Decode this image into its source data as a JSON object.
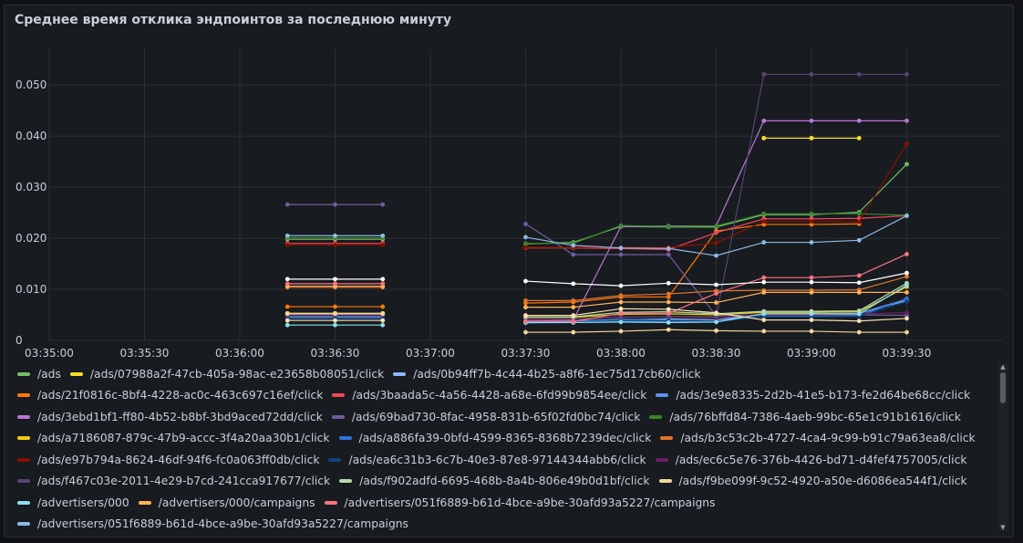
{
  "panel": {
    "title": "Среднее время отклика эндпоинтов за последнюю минуту"
  },
  "chart_data": {
    "type": "line",
    "title": "Среднее время отклика эндпоинтов за последнюю минуту",
    "x_ticks": [
      "03:35:00",
      "03:35:30",
      "03:36:00",
      "03:36:30",
      "03:37:00",
      "03:37:30",
      "03:38:00",
      "03:38:30",
      "03:39:00",
      "03:39:30"
    ],
    "y_ticks": [
      "0",
      "0.010",
      "0.020",
      "0.030",
      "0.040",
      "0.050"
    ],
    "xlim": [
      "03:35:00",
      "03:40:00"
    ],
    "ylim": [
      0,
      0.057
    ],
    "grid": true,
    "legend_position": "bottom",
    "x": [
      "03:36:15",
      "03:36:30",
      "03:36:45",
      "03:37:30",
      "03:37:45",
      "03:38:00",
      "03:38:15",
      "03:38:30",
      "03:38:45",
      "03:39:00",
      "03:39:15",
      "03:39:30"
    ],
    "series": [
      {
        "name": "/ads",
        "color": "#73bf69",
        "values": [
          0.0198,
          0.0198,
          0.0198,
          0.0189,
          0.0192,
          0.0223,
          0.0222,
          0.0222,
          0.0246,
          0.0246,
          0.0251,
          0.0345
        ]
      },
      {
        "name": "/ads/07988a2f-47cb-405a-98ac-e23658b08051/click",
        "color": "#fade2a",
        "values": [
          null,
          null,
          null,
          null,
          null,
          null,
          null,
          null,
          0.0396,
          0.0396,
          0.0396,
          null
        ]
      },
      {
        "name": "/ads/0b94ff7b-4c44-4b25-a8f6-1ec75d17cb60/click",
        "color": "#8ab8ff",
        "values": [
          0.0046,
          0.0046,
          0.0046,
          0.0036,
          0.0037,
          0.004,
          0.0042,
          0.004,
          0.0052,
          0.0052,
          0.0053,
          0.0078
        ]
      },
      {
        "name": "/ads/21f0816c-8bf4-4228-ac0c-463c697c16ef/click",
        "color": "#ff780a",
        "values": [
          0.0066,
          0.0066,
          0.0066,
          0.0073,
          0.0075,
          0.0085,
          0.0085,
          0.0214,
          0.0227,
          0.0227,
          0.0228,
          null
        ]
      },
      {
        "name": "/ads/3baada5c-4a56-4428-a68e-6fd99b9854ee/click",
        "color": "#f2495c",
        "values": [
          0.019,
          0.019,
          0.019,
          0.0181,
          0.0181,
          0.018,
          0.0178,
          0.0211,
          0.0238,
          0.0238,
          0.0239,
          0.0244
        ]
      },
      {
        "name": "/ads/3e9e8335-2d2b-41e5-b173-fe2d64be68cc/click",
        "color": "#5794f2",
        "values": [
          0.0052,
          0.0052,
          0.0052,
          0.0037,
          0.0038,
          0.0041,
          0.004,
          0.0037,
          0.0052,
          0.0052,
          0.0053,
          0.0081
        ]
      },
      {
        "name": "/ads/3ebd1bf1-ff80-4b52-b8bf-3bd9aced72dd/click",
        "color": "#b877d9",
        "values": [
          0.005,
          0.005,
          0.005,
          0.0039,
          0.004,
          0.0223,
          0.0224,
          0.0224,
          0.043,
          0.043,
          0.043,
          0.043
        ]
      },
      {
        "name": "/ads/69bad730-8fac-4958-831b-65f02fd0bc74/click",
        "color": "#705da0",
        "values": [
          0.0266,
          0.0266,
          0.0266,
          0.0228,
          0.0168,
          0.0168,
          0.0168,
          0.0048,
          0.005,
          0.005,
          0.005,
          0.0049
        ]
      },
      {
        "name": "/ads/76bffd84-7386-4aeb-99bc-65e1c91b1616/click",
        "color": "#37872d",
        "values": [
          0.0201,
          0.0201,
          0.0201,
          0.019,
          0.019,
          0.0225,
          0.0223,
          0.0224,
          0.0248,
          0.0248,
          0.0248,
          0.0245
        ]
      },
      {
        "name": "/ads/a7186087-879c-47b9-accc-3f4a20aa30b1/click",
        "color": "#f2cc0c",
        "values": [
          0.0053,
          0.0053,
          0.0053,
          0.0045,
          0.0045,
          0.0051,
          0.0052,
          0.005,
          0.0055,
          0.0055,
          0.0056,
          0.0105
        ]
      },
      {
        "name": "/ads/a886fa39-0bfd-4599-8365-8368b7239dec/click",
        "color": "#3274d9",
        "values": [
          0.0043,
          0.0043,
          0.0043,
          0.0034,
          0.0035,
          0.0037,
          0.0038,
          0.0037,
          0.0047,
          0.0047,
          0.0048,
          0.0082
        ]
      },
      {
        "name": "/ads/b3c53c2b-4727-4ca4-9c99-b91c79a63ea8/click",
        "color": "#e0752d",
        "values": [
          0.0104,
          0.0104,
          0.0104,
          0.0078,
          0.0078,
          0.0088,
          0.0091,
          0.0097,
          0.0098,
          0.0098,
          0.0099,
          0.0125
        ]
      },
      {
        "name": "/ads/e97b794a-8624-46df-94f6-fc0a063ff0db/click",
        "color": "#890f02",
        "values": [
          0.0187,
          0.0187,
          0.0187,
          0.0182,
          0.0182,
          0.0182,
          0.0182,
          0.0191,
          0.0233,
          0.0233,
          0.0232,
          0.0385
        ]
      },
      {
        "name": "/ads/ea6c31b3-6c7b-40e3-87e8-97144344abb6/click",
        "color": "#0a437c",
        "values": [
          0.0044,
          0.0044,
          0.0044,
          0.0036,
          0.0036,
          0.0039,
          0.0039,
          0.0038,
          0.0046,
          0.0046,
          0.0047,
          0.0076
        ]
      },
      {
        "name": "/ads/ec6c5e76-376b-4426-bd71-d4fef4757005/click",
        "color": "#6d1f62",
        "values": [
          0.0049,
          0.0049,
          0.0049,
          0.0042,
          0.0042,
          0.0046,
          0.0046,
          0.0044,
          0.0051,
          0.0051,
          0.0052,
          0.0054
        ]
      },
      {
        "name": "/ads/f467c03e-2011-4e29-b7cd-241cca917677/click",
        "color": "#584477",
        "values": [
          0.0051,
          0.0051,
          0.0051,
          0.004,
          0.0041,
          0.0045,
          0.0047,
          0.0046,
          0.0521,
          0.0521,
          0.0521,
          0.0521
        ]
      },
      {
        "name": "/ads/f902adfd-6695-468b-8a4b-806e49b0d1bf/click",
        "color": "#b7dbab",
        "values": [
          0.0052,
          0.0052,
          0.0052,
          0.0046,
          0.0046,
          0.0055,
          0.0056,
          0.0052,
          0.0057,
          0.0057,
          0.0058,
          0.0112
        ]
      },
      {
        "name": "/ads/f9be099f-9c52-4920-a50e-d6086ea544f1/click",
        "color": "#f4d598",
        "values": [
          0.0053,
          0.0053,
          0.0053,
          0.0016,
          0.0016,
          0.0018,
          0.0021,
          0.0019,
          0.0018,
          0.0018,
          0.0016,
          0.0016
        ]
      },
      {
        "name": "/advertisers/000",
        "color": "#8ae0f0",
        "values": [
          0.003,
          0.003,
          0.003,
          0.0035,
          0.0035,
          0.0036,
          0.0035,
          0.0036,
          0.0052,
          0.0052,
          0.0052,
          0.0108
        ]
      },
      {
        "name": "/advertisers/000/campaigns",
        "color": "#ffb357",
        "values": [
          0.0106,
          0.0106,
          0.0106,
          0.0065,
          0.0065,
          0.0075,
          0.0075,
          0.0074,
          0.0094,
          0.0094,
          0.0094,
          0.0094
        ]
      },
      {
        "name": "/advertisers/051f6889-b61d-4bce-a9be-30afd93a5227/campaigns",
        "color": "#ff7383",
        "values": [
          0.0111,
          0.0111,
          0.0111,
          0.0037,
          0.0037,
          0.0053,
          0.0053,
          0.0092,
          0.0123,
          0.0123,
          0.0127,
          0.0169
        ]
      },
      {
        "name": "/advertisers/051f6889-b61d-4bce-a9be-30afd93a5227/campaigns",
        "color": "#8fb9e6",
        "values": [
          0.0205,
          0.0205,
          0.0205,
          0.0202,
          0.0186,
          0.0181,
          0.018,
          0.0166,
          0.0192,
          0.0192,
          0.0196,
          0.0244
        ]
      },
      {
        "name": "",
        "color": "#ffffff",
        "values": [
          0.012,
          0.012,
          0.012,
          0.0116,
          0.0111,
          0.0107,
          0.0112,
          0.0109,
          0.0114,
          0.0114,
          0.0113,
          0.0132
        ]
      },
      {
        "name": "",
        "color": "#fbe0b0",
        "values": [
          0.0039,
          0.0039,
          0.0039,
          0.0049,
          0.0049,
          0.0062,
          0.0061,
          0.0054,
          0.004,
          0.004,
          0.0038,
          0.0043
        ]
      }
    ]
  },
  "legend": {
    "rows": [
      [
        0,
        1,
        2
      ],
      [
        3,
        4,
        5
      ],
      [
        6,
        7,
        8
      ],
      [
        9,
        10,
        11
      ],
      [
        12,
        13,
        14
      ],
      [
        15,
        16,
        17
      ],
      [
        18,
        19,
        20
      ],
      [
        21
      ]
    ]
  }
}
